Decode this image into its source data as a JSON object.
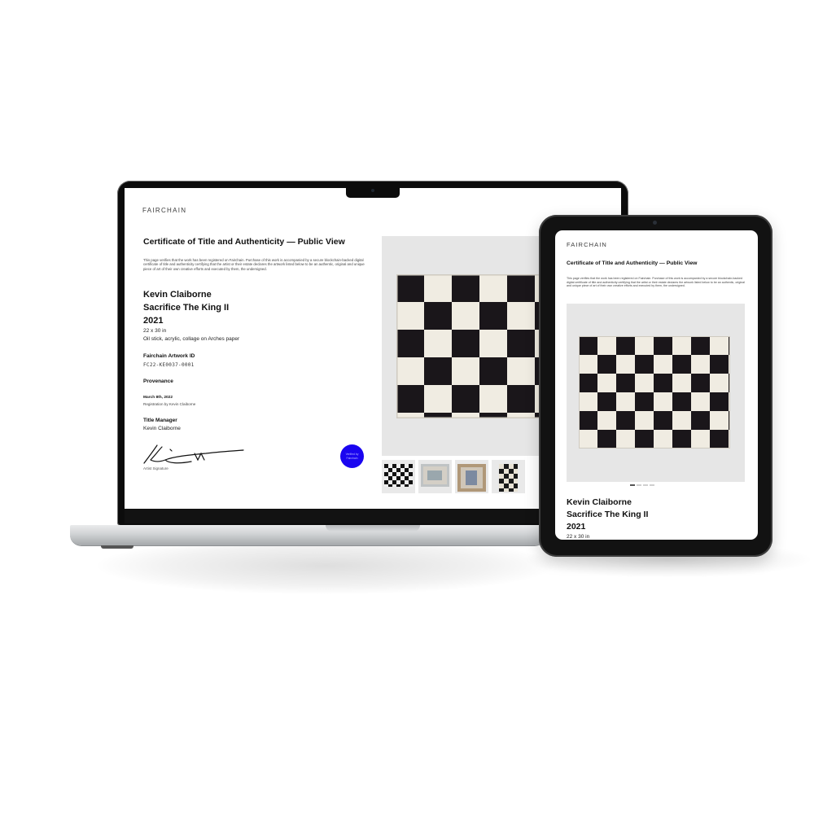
{
  "brand": "FAIRCHAIN",
  "certificate": {
    "title": "Certificate of Title and Authenticity — Public View",
    "description": "This page verifies that the work has been registered on Fairchain. Purchase of this work is accompanied by a secure blockchain-backed digital certificate of title and authenticity certifying that the artist or their estate declares the artwork listed below to be an authentic, original and unique piece of art of their own creative efforts and executed by them, the undersigned."
  },
  "artwork": {
    "artist": "Kevin Claiborne",
    "title": "Sacrifice The King II",
    "year": "2021",
    "dimensions": "22 x 30 in",
    "medium": "Oil stick, acrylic, collage on Arches paper"
  },
  "fairchain_id": {
    "label": "Fairchain Artwork ID",
    "value": "FC22-KE0037-0001"
  },
  "provenance": {
    "label": "Provenance",
    "date": "March 8th, 2022",
    "event": "Registration by Kevin Claiborne"
  },
  "title_manager": {
    "label": "Title Manager",
    "value": "Kevin Claiborne"
  },
  "signature_label": "Artist Signature",
  "badge_text": "Verified by Fairchain",
  "carousel": {
    "slide_count": 4,
    "active_index": 0
  },
  "colors": {
    "badge": "#1a05f0",
    "art_panel_bg": "#e6e6e6"
  }
}
